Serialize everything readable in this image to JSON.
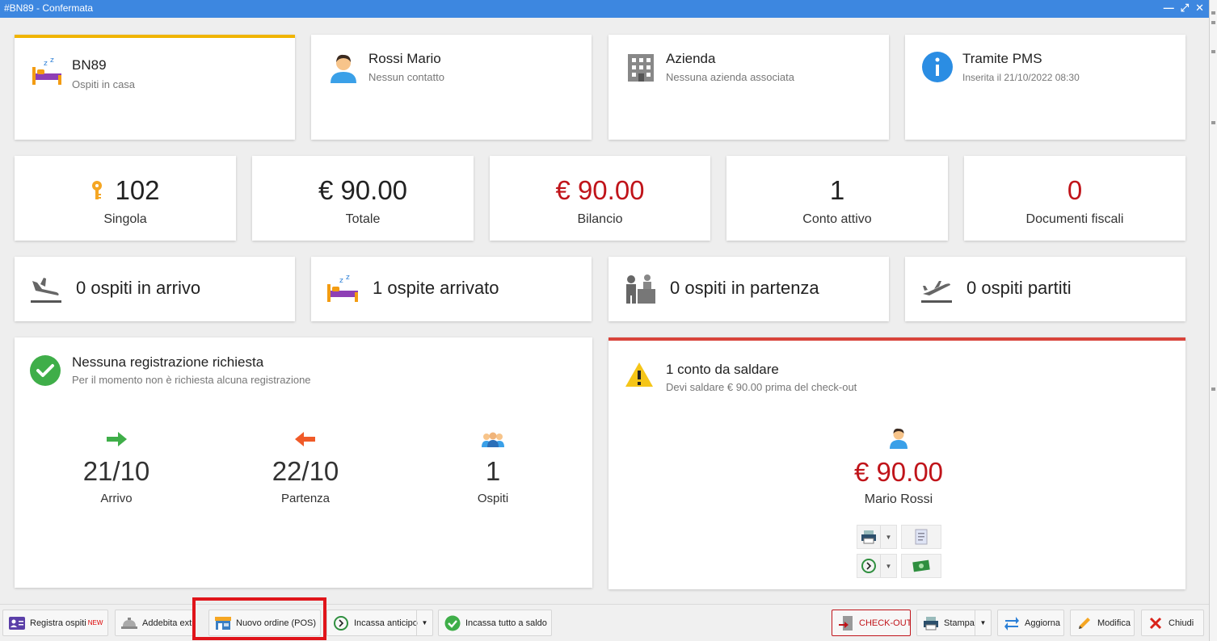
{
  "window": {
    "title": "#BN89 - Confermata"
  },
  "info_cards": [
    {
      "title": "BN89",
      "subtitle": "Ospiti in casa",
      "icon": "sleeping-bed-icon"
    },
    {
      "title": "Rossi Mario",
      "subtitle": "Nessun contatto",
      "icon": "person-icon"
    },
    {
      "title": "Azienda",
      "subtitle": "Nessuna azienda associata",
      "icon": "building-icon"
    },
    {
      "title": "Tramite PMS",
      "subtitle": "Inserita il 21/10/2022 08:30",
      "icon": "info-icon"
    }
  ],
  "stats": [
    {
      "value": "102",
      "label": "Singola",
      "icon": "key-icon"
    },
    {
      "value": "€ 90.00",
      "label": "Totale"
    },
    {
      "value": "€ 90.00",
      "label": "Bilancio"
    },
    {
      "value": "1",
      "label": "Conto attivo"
    },
    {
      "value": "0",
      "label": "Documenti fiscali"
    }
  ],
  "movements": [
    {
      "text": "0 ospiti in arrivo",
      "icon": "plane-landing-icon"
    },
    {
      "text": "1 ospite arrivato",
      "icon": "sleeping-bed-icon"
    },
    {
      "text": "0 ospiti in partenza",
      "icon": "reception-desk-icon"
    },
    {
      "text": "0 ospiti partiti",
      "icon": "plane-takeoff-icon"
    }
  ],
  "registration": {
    "title": "Nessuna registrazione richiesta",
    "subtitle": "Per il momento non è richiesta alcuna registrazione",
    "arrival": {
      "value": "21/10",
      "label": "Arrivo"
    },
    "departure": {
      "value": "22/10",
      "label": "Partenza"
    },
    "guests": {
      "value": "1",
      "label": "Ospiti"
    }
  },
  "billing": {
    "title": "1 conto da saldare",
    "subtitle": "Devi saldare € 90.00 prima del check-out",
    "amount": "€ 90.00",
    "name": "Mario Rossi"
  },
  "toolbar": {
    "registra": "Registra ospiti",
    "registra_badge": "NEW",
    "addebita": "Addebita extr",
    "nuovo_ordine": "Nuovo ordine (POS)",
    "incassa_anticipo": "Incassa anticipo",
    "incassa_tutto": "Incassa tutto a saldo",
    "checkout": "CHECK-OUT",
    "stampa": "Stampa",
    "aggiorna": "Aggiorna",
    "modifica": "Modifica",
    "chiudi": "Chiudi"
  },
  "colors": {
    "accent": "#3d87e0",
    "warning_bar": "#f0b400",
    "alert_bar": "#d9443b",
    "negative": "#c0141a"
  }
}
